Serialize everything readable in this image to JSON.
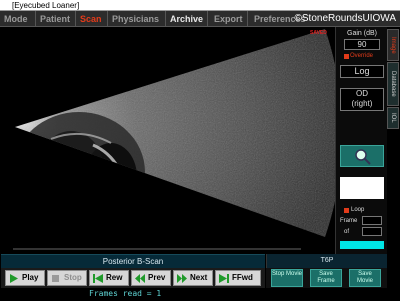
{
  "window": {
    "title": "[Eyecubed Loaner]"
  },
  "menu": {
    "items": [
      {
        "label": "Mode",
        "state": "normal"
      },
      {
        "label": "Patient",
        "state": "normal"
      },
      {
        "label": "Scan",
        "state": "active"
      },
      {
        "label": "Physicians",
        "state": "normal"
      },
      {
        "label": "Archive",
        "state": "bright"
      },
      {
        "label": "Export",
        "state": "normal"
      },
      {
        "label": "Preferences",
        "state": "normal"
      }
    ],
    "watermark": "©StoneRoundsUIOWA"
  },
  "scan": {
    "saved_label": "SAVED"
  },
  "panel": {
    "gain_label": "Gain (dB)",
    "gain_value": "90",
    "override_label": "Override",
    "scale_value": "Log",
    "eye_value": "OD",
    "eye_side": "(right)",
    "loop_label": "Loop",
    "frame_label": "Frame",
    "of_label": "of"
  },
  "sidetabs": [
    "Image",
    "Database",
    "IOL"
  ],
  "caption": {
    "title": "Posterior B-Scan",
    "probe": "T6P"
  },
  "controls": {
    "play": "Play",
    "stop": "Stop",
    "rew": "Rew",
    "prev": "Prev",
    "next": "Next",
    "ffwd": "FFwd"
  },
  "movie_buttons": [
    "Stop Movie",
    "Save Frame",
    "Save Movie"
  ],
  "status": {
    "text": "Frames read = 1"
  },
  "colors": {
    "accent": "#e23b1a",
    "panel_teal": "#1b6f68",
    "cyan": "#00e5e5",
    "status_text": "#5fd3d3"
  }
}
